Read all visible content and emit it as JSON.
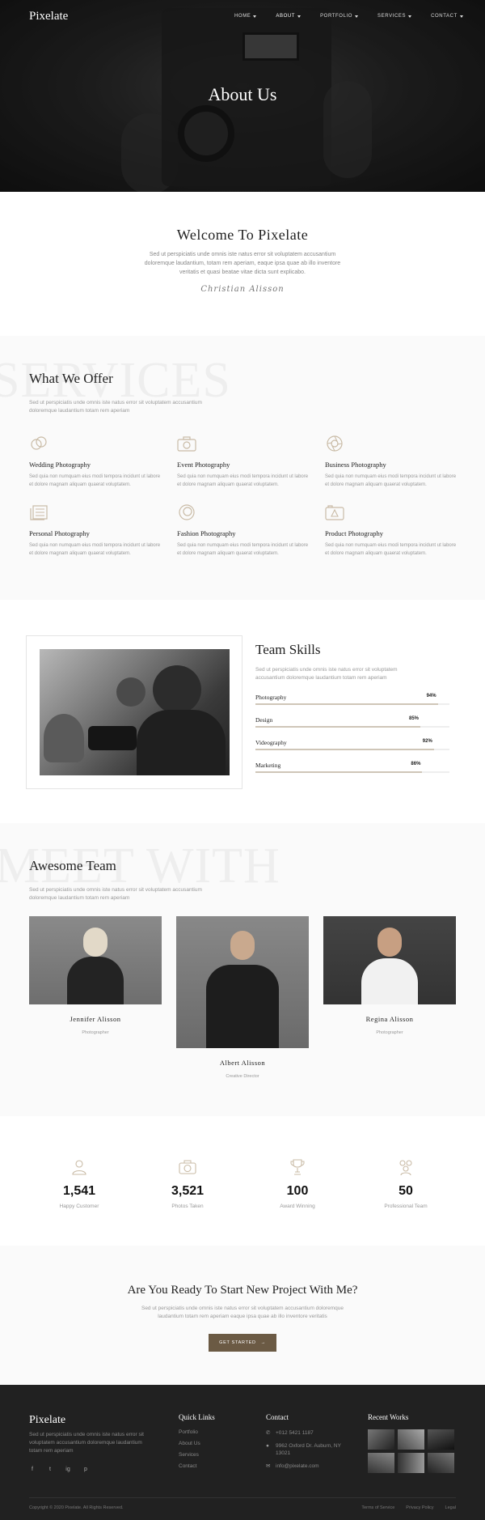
{
  "header": {
    "logo": "Pixelate",
    "nav": [
      {
        "label": "HOME"
      },
      {
        "label": "ABOUT"
      },
      {
        "label": "PORTFOLIO"
      },
      {
        "label": "SERVICES"
      },
      {
        "label": "CONTACT"
      }
    ]
  },
  "hero": {
    "title": "About Us"
  },
  "welcome": {
    "title": "Welcome To Pixelate",
    "text": "Sed ut perspiciatis unde omnis iste natus error sit voluptatem accusantium doloremque laudantium, totam rem aperiam, eaque ipsa quae ab illo inventore veritatis et quasi beatae vitae dicta sunt explicabo.",
    "signature": "Christian Alisson"
  },
  "services": {
    "ghost": "SERVICES",
    "title": "What We Offer",
    "desc": "Sed ut perspiciatis unde omnis iste natus error sit voluptatem accusantium doloremque laudantium totam rem aperiam",
    "items": [
      {
        "name": "Wedding Photography",
        "text": "Sed quia non numquam eius modi tempora incidunt ut labore et dolore magnam aliquam quaerat voluptatem.",
        "icon": "rings-icon"
      },
      {
        "name": "Event Photography",
        "text": "Sed quia non numquam eius modi tempora incidunt ut labore et dolore magnam aliquam quaerat voluptatem.",
        "icon": "camera-icon"
      },
      {
        "name": "Business Photography",
        "text": "Sed quia non numquam eius modi tempora incidunt ut labore et dolore magnam aliquam quaerat voluptatem.",
        "icon": "aperture-icon"
      },
      {
        "name": "Personal Photography",
        "text": "Sed quia non numquam eius modi tempora incidunt ut labore et dolore magnam aliquam quaerat voluptatem.",
        "icon": "photos-icon"
      },
      {
        "name": "Fashion Photography",
        "text": "Sed quia non numquam eius modi tempora incidunt ut labore et dolore magnam aliquam quaerat voluptatem.",
        "icon": "lens-icon"
      },
      {
        "name": "Product Photography",
        "text": "Sed quia non numquam eius modi tempora incidunt ut labore et dolore magnam aliquam quaerat voluptatem.",
        "icon": "polaroid-icon"
      }
    ]
  },
  "skills": {
    "title": "Team Skills",
    "desc": "Sed ut perspiciatis unde omnis iste natus error sit voluptatem accusantium doloremque laudantium totam rem aperiam",
    "bars": [
      {
        "label": "Photography",
        "percent": "94%",
        "value": 94
      },
      {
        "label": "Design",
        "percent": "85%",
        "value": 85
      },
      {
        "label": "Videography",
        "percent": "92%",
        "value": 92
      },
      {
        "label": "Marketing",
        "percent": "86%",
        "value": 86
      }
    ]
  },
  "team": {
    "ghost": "MEET WITH",
    "title": "Awesome Team",
    "desc": "Sed ut perspiciatis unde omnis iste natus error sit voluptatem accusantium doloremque laudantium totam rem aperiam",
    "members": [
      {
        "name": "Jennifer Alisson",
        "role": "Photographer"
      },
      {
        "name": "Albert Alisson",
        "role": "Creative Director"
      },
      {
        "name": "Regina Alisson",
        "role": "Photographer"
      }
    ]
  },
  "stats": [
    {
      "value": "1,541",
      "label": "Happy Customer",
      "icon": "user-icon"
    },
    {
      "value": "3,521",
      "label": "Photos Taken",
      "icon": "camera-icon"
    },
    {
      "value": "100",
      "label": "Award Winning",
      "icon": "trophy-icon"
    },
    {
      "value": "50",
      "label": "Professional Team",
      "icon": "team-icon"
    }
  ],
  "cta": {
    "title": "Are You Ready To Start New Project With Me?",
    "text": "Sed ut perspiciatis unde omnis iste natus error sit voluptatem accusantium doloremque laudantium totam rem aperiam eaque ipsa quae ab illo inventore veritatis",
    "button": "GET STARTED"
  },
  "footer": {
    "logo": "Pixelate",
    "desc": "Sed ut perspiciatis unde omnis iste natus error sit voluptatem accusantium doloremque laudantium totam rem aperiam",
    "social": [
      "f",
      "t",
      "ig",
      "p"
    ],
    "quick_links_title": "Quick Links",
    "quick_links": [
      "Portfolio",
      "About Us",
      "Services",
      "Contact"
    ],
    "contact_title": "Contact",
    "phone": "+012 5421 1187",
    "address": "9962 Oxford Dr. Auburn, NY 13021",
    "email": "info@pixelate.com",
    "recent_title": "Recent Works",
    "copyright": "Copyright © 2020 Pixelate. All Rights Reserved.",
    "legal": [
      "Terms of Service",
      "Privacy Policy",
      "Legal"
    ]
  },
  "colors": {
    "accent": "#6b5a44",
    "bar": "#cfc6b8",
    "footer": "#212121",
    "icon": "#c9bba6"
  }
}
